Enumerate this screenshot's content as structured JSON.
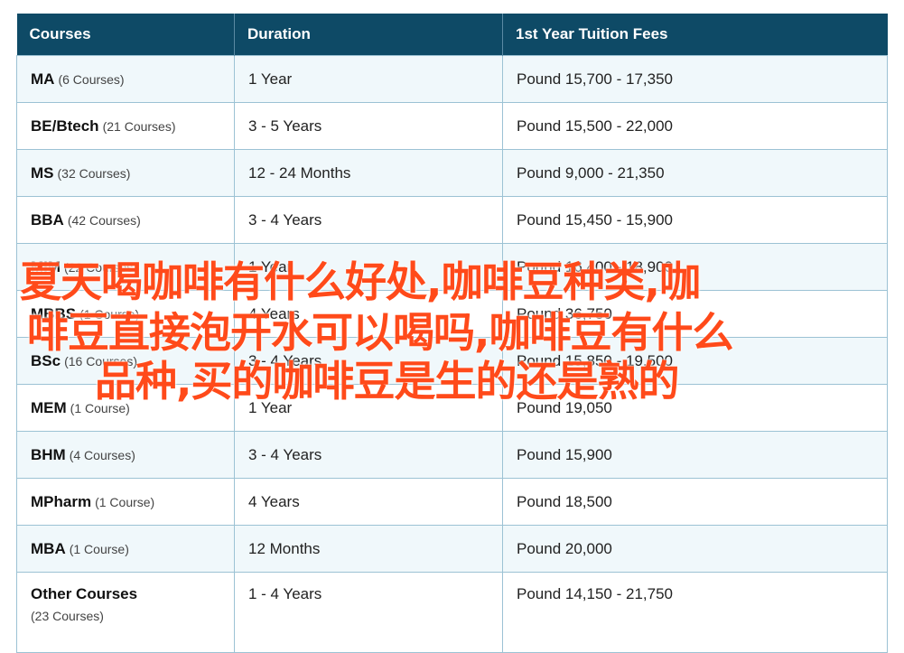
{
  "table": {
    "headers": [
      "Courses",
      "Duration",
      "1st Year Tuition Fees"
    ],
    "rows": [
      {
        "course": "MA",
        "count": "(6 Courses)",
        "duration": "1 Year",
        "fees": "Pound 15,700 - 17,350"
      },
      {
        "course": "BE/Btech",
        "count": "(21 Courses)",
        "duration": "3 - 5 Years",
        "fees": "Pound 15,500 - 22,000"
      },
      {
        "course": "MS",
        "count": "(32 Courses)",
        "duration": "12 - 24 Months",
        "fees": "Pound 9,000 - 21,350"
      },
      {
        "course": "BBA",
        "count": "(42 Courses)",
        "duration": "3 - 4 Years",
        "fees": "Pound 15,450 - 15,900"
      },
      {
        "course": "MIM",
        "count": "(22 Courses)",
        "duration": "1 Year",
        "fees": "Pound 16,400 - 18,900"
      },
      {
        "course": "MBBS",
        "count": "(1 Course)",
        "duration": "4 Years",
        "fees": "Pound 36,750"
      },
      {
        "course": "BSc",
        "count": "(16 Courses)",
        "duration": "3 - 4 Years",
        "fees": "Pound 15,850 - 19,500"
      },
      {
        "course": "MEM",
        "count": "(1 Course)",
        "duration": "1 Year",
        "fees": "Pound 19,050"
      },
      {
        "course": "BHM",
        "count": "(4 Courses)",
        "duration": "3 - 4 Years",
        "fees": "Pound 15,900"
      },
      {
        "course": "MPharm",
        "count": "(1 Course)",
        "duration": "4 Years",
        "fees": "Pound 18,500"
      },
      {
        "course": "MBA",
        "count": "(1 Course)",
        "duration": "12 Months",
        "fees": "Pound 20,000"
      },
      {
        "course": "Other Courses",
        "count": "(23 Courses)",
        "duration": "1 - 4 Years",
        "fees": "Pound 14,150 - 21,750"
      }
    ]
  },
  "overlay": {
    "lines": [
      "夏天喝咖啡有什么好处,咖啡豆种类,咖",
      "啡豆直接泡开水可以喝吗,咖啡豆有什么",
      "品种,买的咖啡豆是生的还是熟的"
    ],
    "color": "#ff4a1a"
  },
  "colors": {
    "header_bg": "#0e4a66",
    "row_alt_bg": "#f0f8fb",
    "border": "#9cc2d4"
  }
}
